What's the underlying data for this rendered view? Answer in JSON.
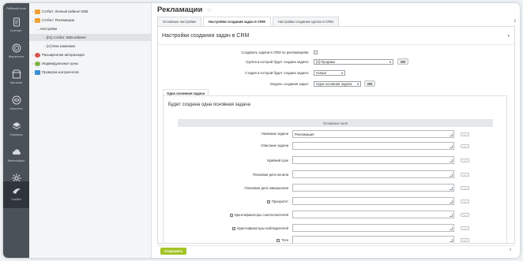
{
  "leftbar": {
    "top_label": "Рабочий стол",
    "items": [
      {
        "label": "Контакт",
        "icon": "document-icon"
      },
      {
        "label": "Маркетинг",
        "icon": "target-icon"
      },
      {
        "label": "Магазин",
        "icon": "shop-icon"
      },
      {
        "label": "Клиенты",
        "icon": "clients-icon"
      },
      {
        "label": "Сервисы",
        "icon": "layers-icon"
      },
      {
        "label": "Marketplace",
        "icon": "cloud-icon"
      },
      {
        "label": "Настройки",
        "icon": "gear-icon"
      },
      {
        "label": "Сотбит",
        "icon": "sotbit-icon"
      }
    ]
  },
  "tree": {
    "items": [
      {
        "label": "Сотбит: Личный кабинет B2B",
        "icon_color": "#f0a030"
      },
      {
        "label": "Сотбит: Рекламации",
        "icon_color": "#f0a030"
      },
      {
        "label": "Настройки",
        "icon_color": ""
      },
      {
        "label": "[b1] Сотбит: B2B кабинет",
        "icon_color": ""
      },
      {
        "label": "[cr] Мои компании",
        "icon_color": ""
      },
      {
        "label": "Расширенная авторизация",
        "icon_color": "#d9534f"
      },
      {
        "label": "Индивидуальные цены",
        "icon_color": "#7bb33f"
      },
      {
        "label": "Проверка контрагентов",
        "icon_color": "#3b8fd6"
      }
    ]
  },
  "page": {
    "title": "Рекламации",
    "tabs": [
      "Основные настройки",
      "Настройки создания задач в CRM",
      "Настройки создания сделок в CRM"
    ],
    "panel_title": "Настройки создания задач в CRM"
  },
  "settings": {
    "create_task_label": "Создавать задачи в CRM по рекламациям:",
    "group_label": "Группа в которой будет создана задача:",
    "group_value": "[3] Продажи",
    "stage_label": "Стадия в которой будет создана задача:",
    "stage_value": "Новые",
    "model_label": "Модель создания задач:",
    "model_value": "Одна основная задача",
    "ok_label": "OK"
  },
  "subsection": {
    "tab_label": "Одна основная задача",
    "title": "Будет создана одна основная задача",
    "bar_label": "Основные поля",
    "fields": [
      {
        "label": "Название задачи",
        "value": "Рекламация",
        "checkbox": false
      },
      {
        "label": "Описание задачи",
        "value": "",
        "checkbox": false
      },
      {
        "label": "Крайний срок",
        "value": "",
        "checkbox": false
      },
      {
        "label": "Плановая дата начала",
        "value": "",
        "checkbox": false
      },
      {
        "label": "Плановая дата завершения",
        "value": "",
        "checkbox": false
      },
      {
        "label": "Приоритет",
        "value": "",
        "checkbox": true
      },
      {
        "label": "Идентификаторы соисполнителей",
        "value": "",
        "checkbox": true
      },
      {
        "label": "Идентификаторы наблюдателей",
        "value": "",
        "checkbox": true
      },
      {
        "label": "Теги",
        "value": "",
        "checkbox": true
      }
    ],
    "dots_label": "..."
  },
  "footer": {
    "save_label": "Сохранить"
  }
}
